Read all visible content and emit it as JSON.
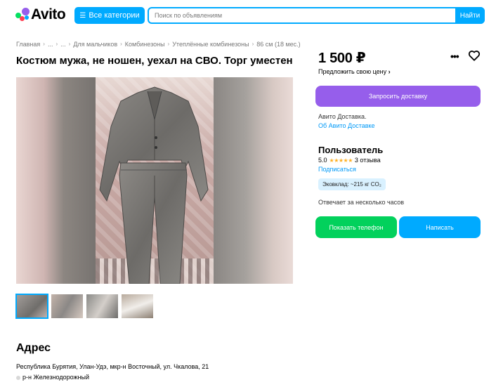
{
  "header": {
    "logo_text": "Avito",
    "categories_label": "Все категории",
    "search_placeholder": "Поиск по объявлениям",
    "search_button": "Найти"
  },
  "breadcrumb": [
    "Главная",
    "...",
    "...",
    "Для мальчиков",
    "Комбинезоны",
    "Утеплённые комбинезоны",
    "86 см (18 мес.)"
  ],
  "listing": {
    "title": "Костюм мужа, не ношен, уехал на СВО. Торг уместен",
    "price": "1 500 ₽",
    "offer_price_label": "Предложить свою цену",
    "thumbnails": 4
  },
  "delivery": {
    "button_label": "Запросить доставку",
    "note": "Авито Доставка.",
    "link": "Об Авито Доставке"
  },
  "seller": {
    "name": "Пользователь",
    "rating": "5.0",
    "stars": "★★★★★",
    "reviews": "3 отзыва",
    "subscribe": "Подписаться",
    "eco_badge": "Эковклад: ~215 кг CO₂",
    "response_time": "Отвечает за несколько часов"
  },
  "actions": {
    "phone_button": "Показать телефон",
    "write_button": "Написать"
  },
  "address": {
    "title": "Адрес",
    "line1": "Республика Бурятия, Улан-Удэ, мкр-н Восточный, ул. Чкалова, 21",
    "line2": "р-н Железнодорожный"
  },
  "colors": {
    "accent_blue": "#00aaff",
    "purple": "#965eeb",
    "green": "#02d15c",
    "link": "#0099f7"
  }
}
